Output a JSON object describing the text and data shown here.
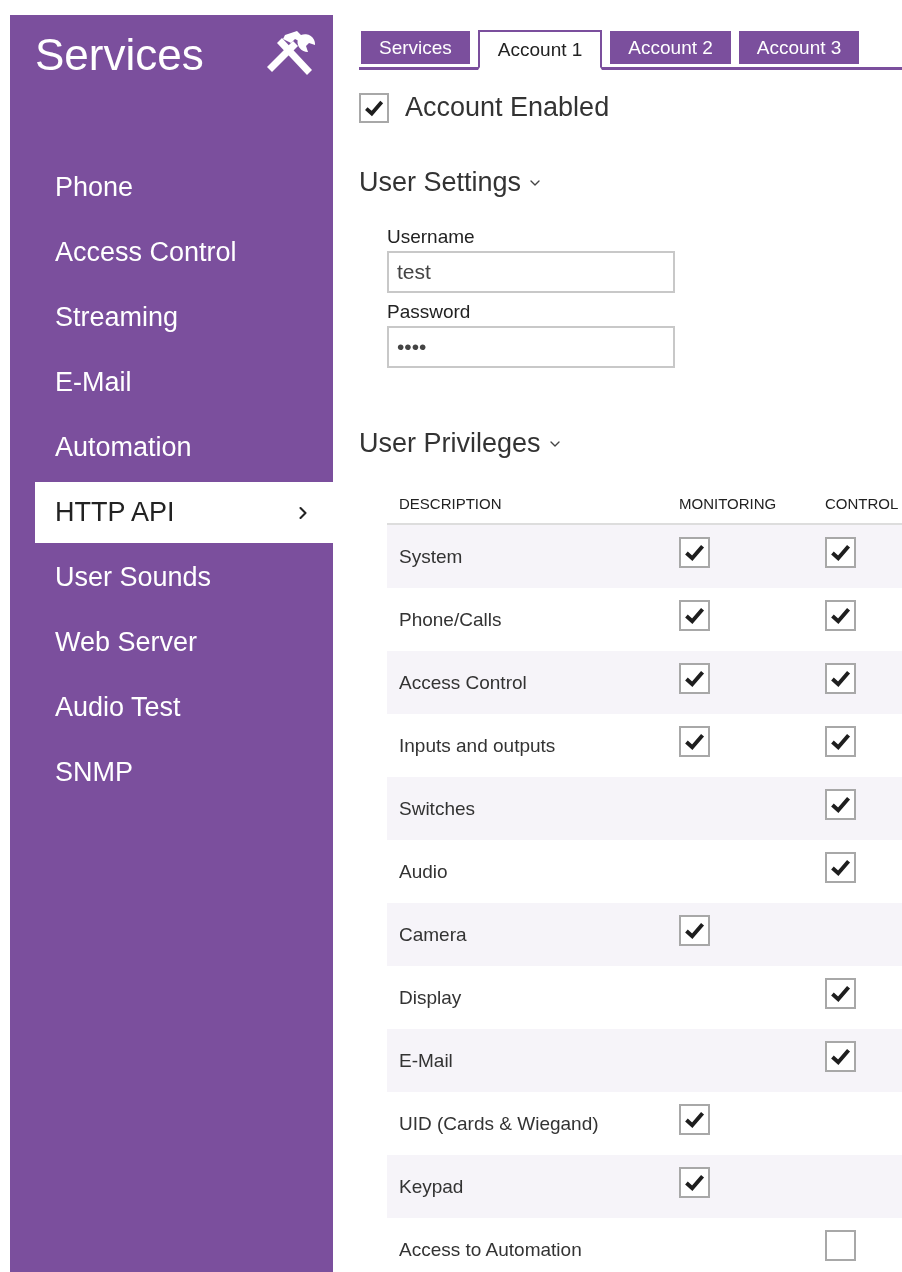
{
  "sidebar": {
    "title": "Services",
    "items": [
      {
        "label": "Phone",
        "selected": false
      },
      {
        "label": "Access Control",
        "selected": false
      },
      {
        "label": "Streaming",
        "selected": false
      },
      {
        "label": "E-Mail",
        "selected": false
      },
      {
        "label": "Automation",
        "selected": false
      },
      {
        "label": "HTTP API",
        "selected": true
      },
      {
        "label": "User Sounds",
        "selected": false
      },
      {
        "label": "Web Server",
        "selected": false
      },
      {
        "label": "Audio Test",
        "selected": false
      },
      {
        "label": "SNMP",
        "selected": false
      }
    ]
  },
  "tabs": [
    {
      "label": "Services",
      "selected": false
    },
    {
      "label": "Account 1",
      "selected": true
    },
    {
      "label": "Account 2",
      "selected": false
    },
    {
      "label": "Account 3",
      "selected": false
    }
  ],
  "account_enabled": {
    "label": "Account Enabled",
    "checked": true
  },
  "user_settings": {
    "title": "User Settings",
    "expanded": true,
    "fields": [
      {
        "label": "Username",
        "value": "test"
      },
      {
        "label": "Password",
        "value": "••••"
      }
    ]
  },
  "user_privileges": {
    "title": "User Privileges",
    "expanded": true,
    "columns": [
      "DESCRIPTION",
      "MONITORING",
      "CONTROL"
    ],
    "rows": [
      {
        "description": "System",
        "monitoring": {
          "checked": true
        },
        "control": {
          "checked": true
        }
      },
      {
        "description": "Phone/Calls",
        "monitoring": {
          "checked": true
        },
        "control": {
          "checked": true
        }
      },
      {
        "description": "Access Control",
        "monitoring": {
          "checked": true
        },
        "control": {
          "checked": true
        }
      },
      {
        "description": "Inputs and outputs",
        "monitoring": {
          "checked": true
        },
        "control": {
          "checked": true
        }
      },
      {
        "description": "Switches",
        "control": {
          "checked": true
        }
      },
      {
        "description": "Audio",
        "control": {
          "checked": true
        }
      },
      {
        "description": "Camera",
        "monitoring": {
          "checked": true
        }
      },
      {
        "description": "Display",
        "control": {
          "checked": true
        }
      },
      {
        "description": "E-Mail",
        "control": {
          "checked": true
        }
      },
      {
        "description": "UID (Cards & Wiegand)",
        "monitoring": {
          "checked": true
        }
      },
      {
        "description": "Keypad",
        "monitoring": {
          "checked": true
        }
      },
      {
        "description": "Access to Automation",
        "control": {
          "checked": false
        }
      }
    ]
  }
}
